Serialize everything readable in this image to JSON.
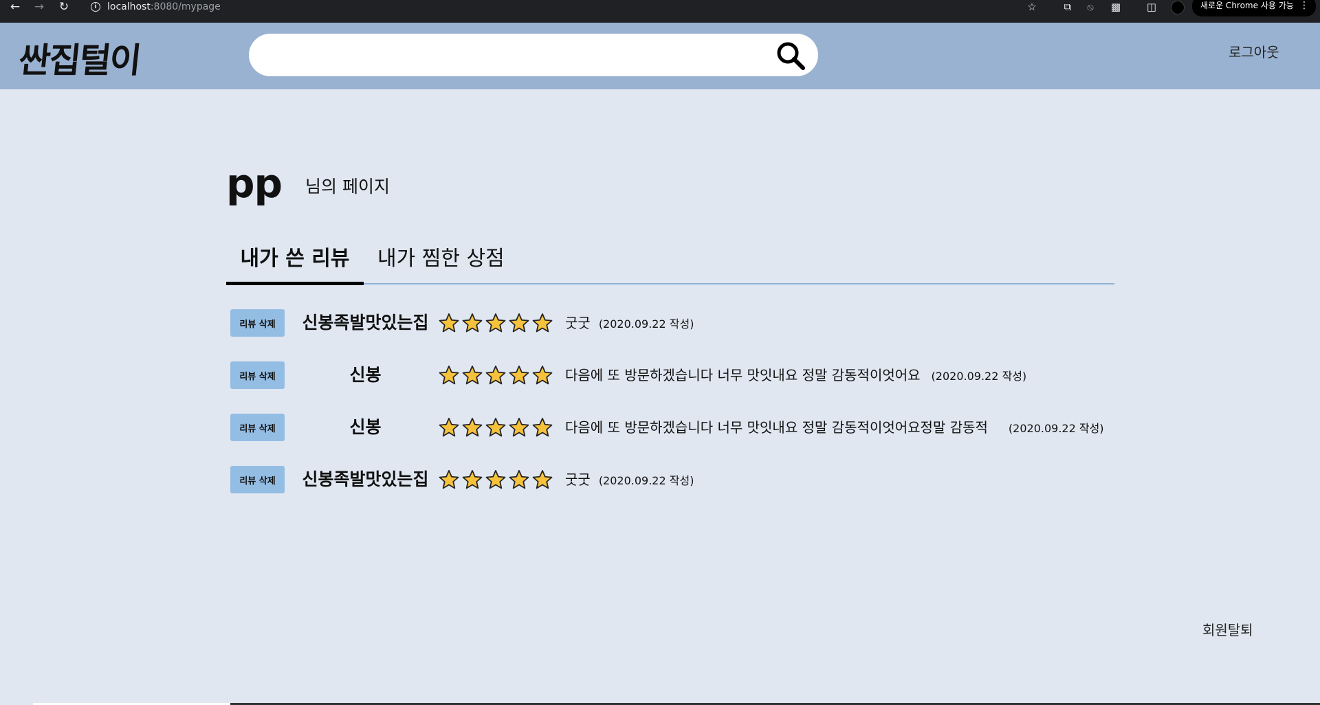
{
  "browser": {
    "url_host": "localhost",
    "url_path": ":8080/mypage",
    "chrome_notice": "새로운 Chrome 사용 가능"
  },
  "header": {
    "logo": "싼집털이",
    "search_placeholder": "",
    "logout_label": "로그아웃"
  },
  "profile": {
    "username": "pp",
    "page_suffix": "님의 페이지"
  },
  "tabs": [
    {
      "label": "내가 쓴 리뷰",
      "active": true
    },
    {
      "label": "내가 찜한 상점",
      "active": false
    }
  ],
  "reviews": [
    {
      "delete_label": "리뷰 삭제",
      "shop": "신봉족발맛있는집",
      "rating": 5,
      "text": "굿굿",
      "date": "(2020.09.22 작성)"
    },
    {
      "delete_label": "리뷰 삭제",
      "shop": "신봉",
      "rating": 5,
      "text": "다음에 또 방문하겠습니다 너무 맛잇내요 정말 감동적이엇어요",
      "date": "(2020.09.22 작성)"
    },
    {
      "delete_label": "리뷰 삭제",
      "shop": "신봉",
      "rating": 5,
      "text": "다음에 또 방문하겠습니다 너무 맛잇내요 정말 감동적이엇어요정말 감동적",
      "date": "(2020.09.22 작성)"
    },
    {
      "delete_label": "리뷰 삭제",
      "shop": "신봉족발맛있는집",
      "rating": 5,
      "text": "굿굿",
      "date": "(2020.09.22 작성)"
    }
  ],
  "footer": {
    "withdraw_label": "회원탈퇴"
  },
  "colors": {
    "header_bg": "#9ab2d1",
    "page_bg": "#e0e7f1",
    "delete_button": "#94bde4",
    "star_fill": "#f7c23b",
    "tab_underline": "#8fb1d6"
  }
}
